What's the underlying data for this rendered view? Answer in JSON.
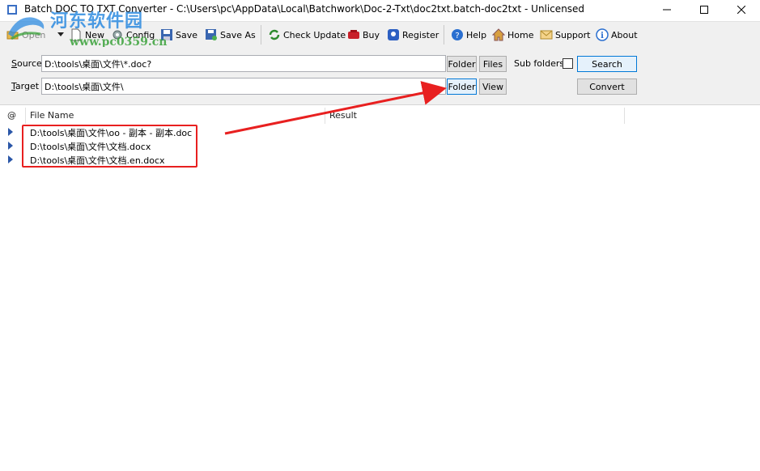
{
  "window": {
    "title": "Batch DOC TO TXT Converter - C:\\Users\\pc\\AppData\\Local\\Batchwork\\Doc-2-Txt\\doc2txt.batch-doc2txt - Unlicensed"
  },
  "watermark": {
    "text": "河东软件园",
    "url": "www.pc0359.cn"
  },
  "toolbar": {
    "open": "Open",
    "new": "New",
    "config": "Config",
    "save": "Save",
    "save_as": "Save As",
    "check_update": "Check Update",
    "buy": "Buy",
    "register": "Register",
    "help": "Help",
    "home": "Home",
    "support": "Support",
    "about": "About"
  },
  "panel": {
    "source_label": "Source",
    "source_value": "D:\\tools\\桌面\\文件\\*.doc?",
    "target_label": "Target",
    "target_value": "D:\\tools\\桌面\\文件\\",
    "folder_label": "Folder",
    "files_label": "Files",
    "view_label": "View",
    "subfolders_label": "Sub folders",
    "subfolders_checked": false,
    "search_label": "Search",
    "convert_label": "Convert"
  },
  "list": {
    "columns": [
      "@",
      "File Name",
      "Result"
    ],
    "rows": [
      "D:\\tools\\桌面\\文件\\oo - 副本 - 副本.doc",
      "D:\\tools\\桌面\\文件\\文档.docx",
      "D:\\tools\\桌面\\文件\\文档.en.docx"
    ]
  },
  "colors": {
    "accent": "#0078d7",
    "annotation": "#e82020",
    "row_arrow": "#2b57a8"
  }
}
